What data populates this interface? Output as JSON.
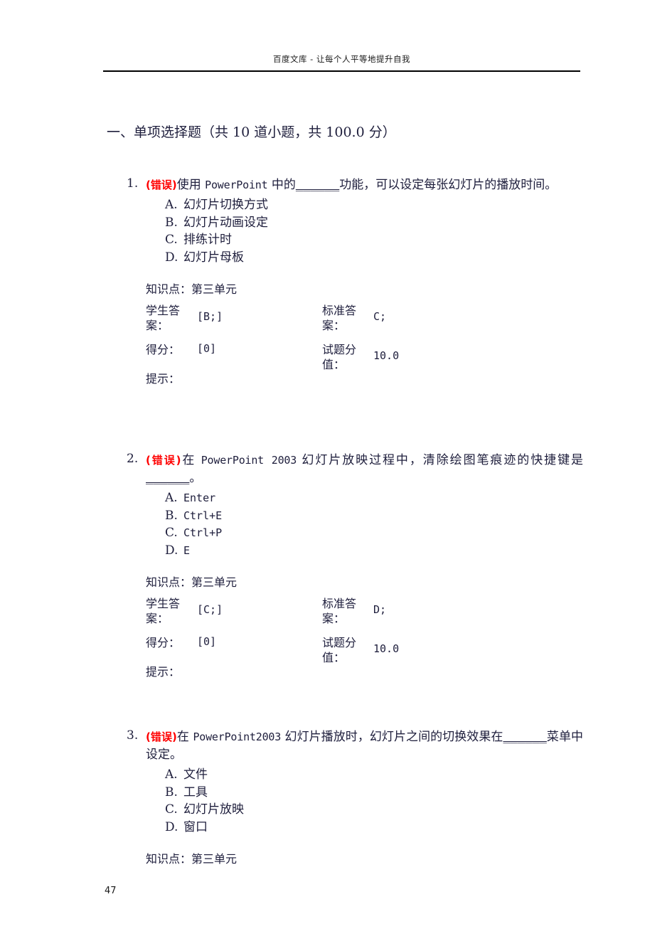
{
  "header": {
    "title": "百度文库 - 让每个人平等地提升自我"
  },
  "section": {
    "title": "一、单项选择题（共 10 道小题，共 100.0 分）"
  },
  "labels": {
    "knowledge_point": "知识点：",
    "student_answer": "学生答案：",
    "standard_answer": "标准答案：",
    "score": "得分：",
    "question_value": "试题分值：",
    "hint": "提示："
  },
  "wrong_tag": "(错误)",
  "questions": [
    {
      "number": "1.",
      "text_pre": "使用 ",
      "text_mono": "PowerPoint",
      "text_mid": " 中的",
      "blank": "______",
      "text_post": "功能，可以设定每张幻灯片的播放时间。",
      "options": [
        {
          "label": "A.",
          "text": "幻灯片切换方式",
          "latin": false
        },
        {
          "label": "B.",
          "text": "幻灯片动画设定",
          "latin": false
        },
        {
          "label": "C.",
          "text": "排练计时",
          "latin": false
        },
        {
          "label": "D.",
          "text": "幻灯片母板",
          "latin": false
        }
      ],
      "knowledge_point": "第三单元",
      "student_answer": "[B;]",
      "standard_answer": "C;",
      "score": "[0]",
      "question_value": "10.0",
      "hint": ""
    },
    {
      "number": "2.",
      "text_pre": "在 ",
      "text_mono": "PowerPoint 2003",
      "text_mid": " 幻灯片放映过程中，清除绘图笔痕迹的快捷键是",
      "blank": "______",
      "text_post": "。",
      "options": [
        {
          "label": "A.",
          "text": "Enter",
          "latin": true
        },
        {
          "label": "B.",
          "text": "Ctrl+E",
          "latin": true
        },
        {
          "label": "C.",
          "text": "Ctrl+P",
          "latin": true
        },
        {
          "label": "D.",
          "text": "E",
          "latin": true
        }
      ],
      "knowledge_point": "第三单元",
      "student_answer": "[C;]",
      "standard_answer": "D;",
      "score": "[0]",
      "question_value": "10.0",
      "hint": ""
    },
    {
      "number": "3.",
      "text_pre": "在 ",
      "text_mono": "PowerPoint2003",
      "text_mid": " 幻灯片播放时，幻灯片之间的切换效果在",
      "blank": "______",
      "text_post": "菜单中设定。",
      "options": [
        {
          "label": "A.",
          "text": "文件",
          "latin": false
        },
        {
          "label": "B.",
          "text": "工具",
          "latin": false
        },
        {
          "label": "C.",
          "text": "幻灯片放映",
          "latin": false
        },
        {
          "label": "D.",
          "text": "窗口",
          "latin": false
        }
      ],
      "knowledge_point": "第三单元",
      "student_answer": "",
      "standard_answer": "",
      "score": "",
      "question_value": "",
      "hint": "",
      "truncated": true
    }
  ],
  "page_number": "47"
}
